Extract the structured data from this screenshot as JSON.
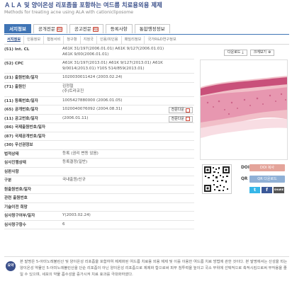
{
  "title": {
    "ko": "ＡＬＡ 및 양이온성 리포좀을 포함하는 여드름 치료용외용 제제",
    "en": "Methods for treating acne using ALA with cationicliposome"
  },
  "tabs_main": [
    {
      "label": "서지정보",
      "pdf": false
    },
    {
      "label": "공개전문",
      "pdf": true
    },
    {
      "label": "공고전문",
      "pdf": true
    },
    {
      "label": "등록사항",
      "pdf": false
    },
    {
      "label": "통합행정정보",
      "pdf": false
    }
  ],
  "tabs_sub": [
    "서지정보",
    "인용정보",
    "협정서비",
    "청구항",
    "지정국",
    "인용/피인용",
    "패밀리정보",
    "국가R&D연구정보"
  ],
  "icons": {
    "pdf": "pdf-icon",
    "download": "download-icon",
    "zoom": "zoom-icon",
    "qr": "qr-code-icon",
    "twitter": "twitter-icon",
    "facebook": "facebook-icon",
    "share": "share-icon"
  },
  "colors": {
    "accent": "#3f74b5",
    "title": "#3a4f8a",
    "doi": "#e4a49a",
    "qr": "#8fb0d6",
    "twitter": "#35b6e8",
    "facebook": "#3b5998"
  },
  "biblio": [
    {
      "label": "(51) Int. CL",
      "lines": [
        "A61K 31/197(2006.01.01) A61K 9/127(2006.01.01)",
        "A61K 9/00(2006.01.01)"
      ]
    },
    {
      "label": "(52) CPC",
      "lines": [
        "A61K 31/197(2013.01) A61K 9/127(2013.01) A61K",
        "9/0014(2013.01) Y10S 514/859(2013.01)"
      ]
    },
    {
      "label": "(21) 출원번호/일자",
      "lines": [
        "1020030011424 (2003.02.24)"
      ]
    },
    {
      "label": "(71) 출원인",
      "lines": [
        "김정철",
        "(주)트라코진"
      ]
    },
    {
      "label": "(11) 등록번호/일자",
      "lines": [
        "1005427880000 (2006.01.05)"
      ]
    },
    {
      "label": "(65) 공개번호/일자",
      "lines": [
        "1020040076092 (2004.08.31)"
      ],
      "button": "전문다운"
    },
    {
      "label": "(11) 공고번호/일자",
      "lines": [
        "(2006.01.11)"
      ],
      "button": "전문다운"
    },
    {
      "label": "(86) 국제출원번호/일자",
      "lines": [
        ""
      ]
    },
    {
      "label": "(87) 국제공개번호/일자",
      "lines": [
        ""
      ]
    },
    {
      "label": "(30) 우선권정보",
      "lines": [
        ""
      ]
    },
    {
      "label": "법적상태",
      "lines": [
        "등록 (권리 변동 있음)"
      ]
    },
    {
      "label": "심사진행상태",
      "lines": [
        "등록결정(일반)"
      ]
    },
    {
      "label": "심판사항",
      "lines": [
        ""
      ]
    },
    {
      "label": "구분",
      "lines": [
        "국내출원/신규"
      ]
    },
    {
      "label": "원출원번호/일자",
      "lines": [
        ""
      ]
    },
    {
      "label": "관련 출원번호",
      "lines": [
        ""
      ]
    },
    {
      "label": "기술이전 희망",
      "lines": [
        ""
      ]
    },
    {
      "label": "심사청구여부/일자",
      "lines": [
        "Y(2003.02.24)"
      ]
    },
    {
      "label": "심사청구항수",
      "lines": [
        "6"
      ]
    }
  ],
  "image_buttons": {
    "download": "다운로드",
    "zoom": "크게보기"
  },
  "doi": {
    "label": "DOI",
    "button": "DOI 복사"
  },
  "qr": {
    "label": "QR",
    "button": "QR 다운로드"
  },
  "sns": {
    "twitter": "t",
    "facebook": "f",
    "share": "SHARE"
  },
  "abstract": {
    "badge": "요약",
    "text": "본 발명은 5-아미노레뷸린산 및 양이온성 리포좀을 포함하여 제제화된 여드름 치료용 외용 제제 및 이를 이용한 여드름 치료 방법에 관한 것이다. 본 발명에서는 산성을 띠는 양이온성 약물인 5-아미노레뷸린산을 단순 리포좀이 아닌 양이온성 리포좀으로 제제화 함으로써 피부 침투력을 높이고 국소 부위에 선택적으로 축적시킴으로써 부작용을 줄일 수 있으며, 세포의 약물 흡수성을 증가시켜 치료 효과를 극대화하였다."
  }
}
